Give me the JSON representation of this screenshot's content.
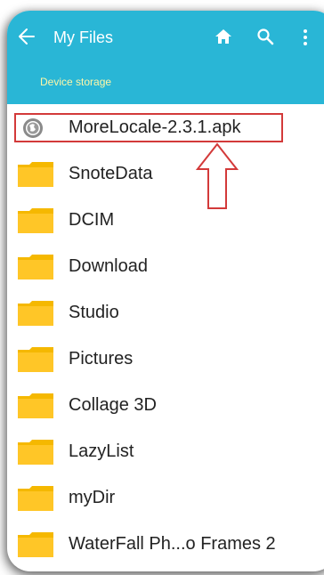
{
  "header": {
    "title": "My Files",
    "breadcrumb": "Device storage",
    "color": "#29b6d6"
  },
  "files": [
    {
      "name": "MoreLocale-2.3.1.apk",
      "icon": "apk-icon",
      "highlighted": true
    },
    {
      "name": "SnoteData",
      "icon": "folder-icon"
    },
    {
      "name": "DCIM",
      "icon": "folder-icon"
    },
    {
      "name": "Download",
      "icon": "folder-icon"
    },
    {
      "name": "Studio",
      "icon": "folder-icon"
    },
    {
      "name": "Pictures",
      "icon": "folder-icon"
    },
    {
      "name": "Collage 3D",
      "icon": "folder-icon"
    },
    {
      "name": "LazyList",
      "icon": "folder-icon"
    },
    {
      "name": "myDir",
      "icon": "folder-icon"
    },
    {
      "name": "WaterFall Ph...o Frames 2",
      "icon": "folder-icon"
    }
  ],
  "annotation": {
    "color": "#d33a3a",
    "arrow_icon": "arrow-up-icon"
  }
}
